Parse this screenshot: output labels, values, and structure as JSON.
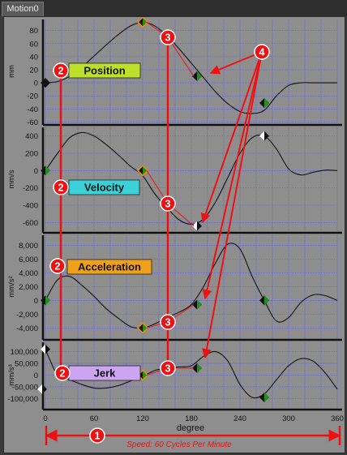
{
  "window": {
    "tab_label": "Motion0"
  },
  "x_axis": {
    "label": "degree",
    "ticks": [
      0,
      60,
      120,
      180,
      240,
      300,
      360
    ],
    "range": [
      0,
      360
    ]
  },
  "panels": [
    {
      "key": "position",
      "unit": "mm",
      "ticks": [
        80,
        60,
        40,
        20,
        0,
        -20,
        -40,
        -60
      ],
      "tick_labels": [
        "80",
        "60",
        "40",
        "20",
        "0",
        "-20",
        "-40",
        "-60"
      ],
      "ylim": [
        -62,
        97
      ],
      "tag": "Position",
      "tag_color": "#bde02a",
      "callout": "2"
    },
    {
      "key": "velocity",
      "unit": "mm/s",
      "ticks": [
        400,
        200,
        0,
        -200,
        -400,
        -600
      ],
      "tick_labels": [
        "400",
        "200",
        "0",
        "-200",
        "-400",
        "-600"
      ],
      "ylim": [
        -700,
        500
      ],
      "tag": "Velocity",
      "tag_color": "#3ad1d8",
      "callout": "2"
    },
    {
      "key": "acceleration",
      "unit": "mm/s²",
      "ticks": [
        8000,
        6000,
        4000,
        2000,
        0,
        -2000,
        -4000
      ],
      "tick_labels": [
        "8,000",
        "6,000",
        "4,000",
        "2,000",
        "0",
        "-2,000",
        "-4,000"
      ],
      "ylim": [
        -5500,
        9500
      ],
      "tag": "Acceleration",
      "tag_color": "#f0a11c",
      "callout": "2"
    },
    {
      "key": "jerk",
      "unit": "mm/s³",
      "ticks": [
        100000,
        50000,
        0,
        -50000,
        -100000
      ],
      "tick_labels": [
        "100,000",
        "50,000",
        "0",
        "-50,000",
        "-100,000"
      ],
      "ylim": [
        -140000,
        140000
      ],
      "tag": "Jerk",
      "tag_color": "#cba4f2",
      "callout": "2"
    }
  ],
  "callouts": {
    "speed": "1",
    "segment_boundary": "3",
    "points": "4"
  },
  "speed_text": "Speed: 60 Cycles Per Minute",
  "colors": {
    "background": "#8e8e8e",
    "grid": "#5c5ccf",
    "curve": "#111111",
    "annotation": "#ee1111",
    "knot_green": "#1f8f1f",
    "knot_orange": "#f08a10"
  },
  "chart_data": [
    {
      "type": "line",
      "x": [
        0,
        15,
        30,
        45,
        60,
        75,
        90,
        105,
        120,
        135,
        150,
        165,
        180,
        195,
        210,
        225,
        240,
        255,
        270,
        285,
        300,
        315,
        330,
        345,
        360
      ],
      "series": [
        {
          "values": [
            0,
            2,
            10,
            24,
            41,
            58,
            74,
            87,
            93,
            87,
            72,
            52,
            30,
            8,
            -14,
            -32,
            -44,
            -47,
            -42,
            -20,
            -4,
            0,
            0,
            0,
            0
          ]
        }
      ],
      "xlabel": "degree",
      "ylabel": "mm",
      "ylim": [
        -62,
        97
      ]
    },
    {
      "type": "line",
      "x": [
        0,
        15,
        30,
        45,
        60,
        75,
        90,
        105,
        120,
        135,
        150,
        165,
        180,
        195,
        210,
        225,
        240,
        255,
        270,
        285,
        300,
        315,
        330,
        345,
        360
      ],
      "series": [
        {
          "values": [
            0,
            200,
            380,
            440,
            400,
            300,
            180,
            50,
            -60,
            -270,
            -430,
            -570,
            -620,
            -560,
            -360,
            -80,
            200,
            380,
            400,
            250,
            20,
            -50,
            -20,
            5,
            0
          ]
        }
      ],
      "xlabel": "degree",
      "ylabel": "mm/s",
      "ylim": [
        -700,
        500
      ]
    },
    {
      "type": "line",
      "x": [
        0,
        15,
        30,
        45,
        60,
        75,
        90,
        105,
        120,
        135,
        150,
        165,
        180,
        195,
        210,
        225,
        240,
        255,
        270,
        285,
        300,
        315,
        330,
        345,
        360
      ],
      "series": [
        {
          "values": [
            0,
            3000,
            3500,
            2200,
            600,
            -1200,
            -2600,
            -3800,
            -4000,
            -3400,
            -2500,
            -1700,
            -600,
            2000,
            5500,
            8200,
            7500,
            3500,
            0,
            -3000,
            -2500,
            -300,
            800,
            700,
            0
          ]
        }
      ],
      "xlabel": "degree",
      "ylabel": "mm/s²",
      "ylim": [
        -5500,
        9500
      ]
    },
    {
      "type": "line",
      "x": [
        0,
        15,
        30,
        45,
        60,
        75,
        90,
        105,
        120,
        135,
        150,
        165,
        180,
        195,
        210,
        225,
        240,
        255,
        270,
        285,
        300,
        315,
        330,
        345,
        360
      ],
      "series": [
        {
          "values": [
            110000,
            0,
            -20000,
            -40000,
            -55000,
            -55000,
            -45000,
            -25000,
            -5000,
            20000,
            30000,
            35000,
            40000,
            80000,
            100000,
            60000,
            -40000,
            -95000,
            -80000,
            -20000,
            40000,
            70000,
            60000,
            10000,
            -60000
          ]
        }
      ],
      "xlabel": "degree",
      "ylabel": "mm/s³",
      "ylim": [
        -140000,
        140000
      ]
    }
  ]
}
